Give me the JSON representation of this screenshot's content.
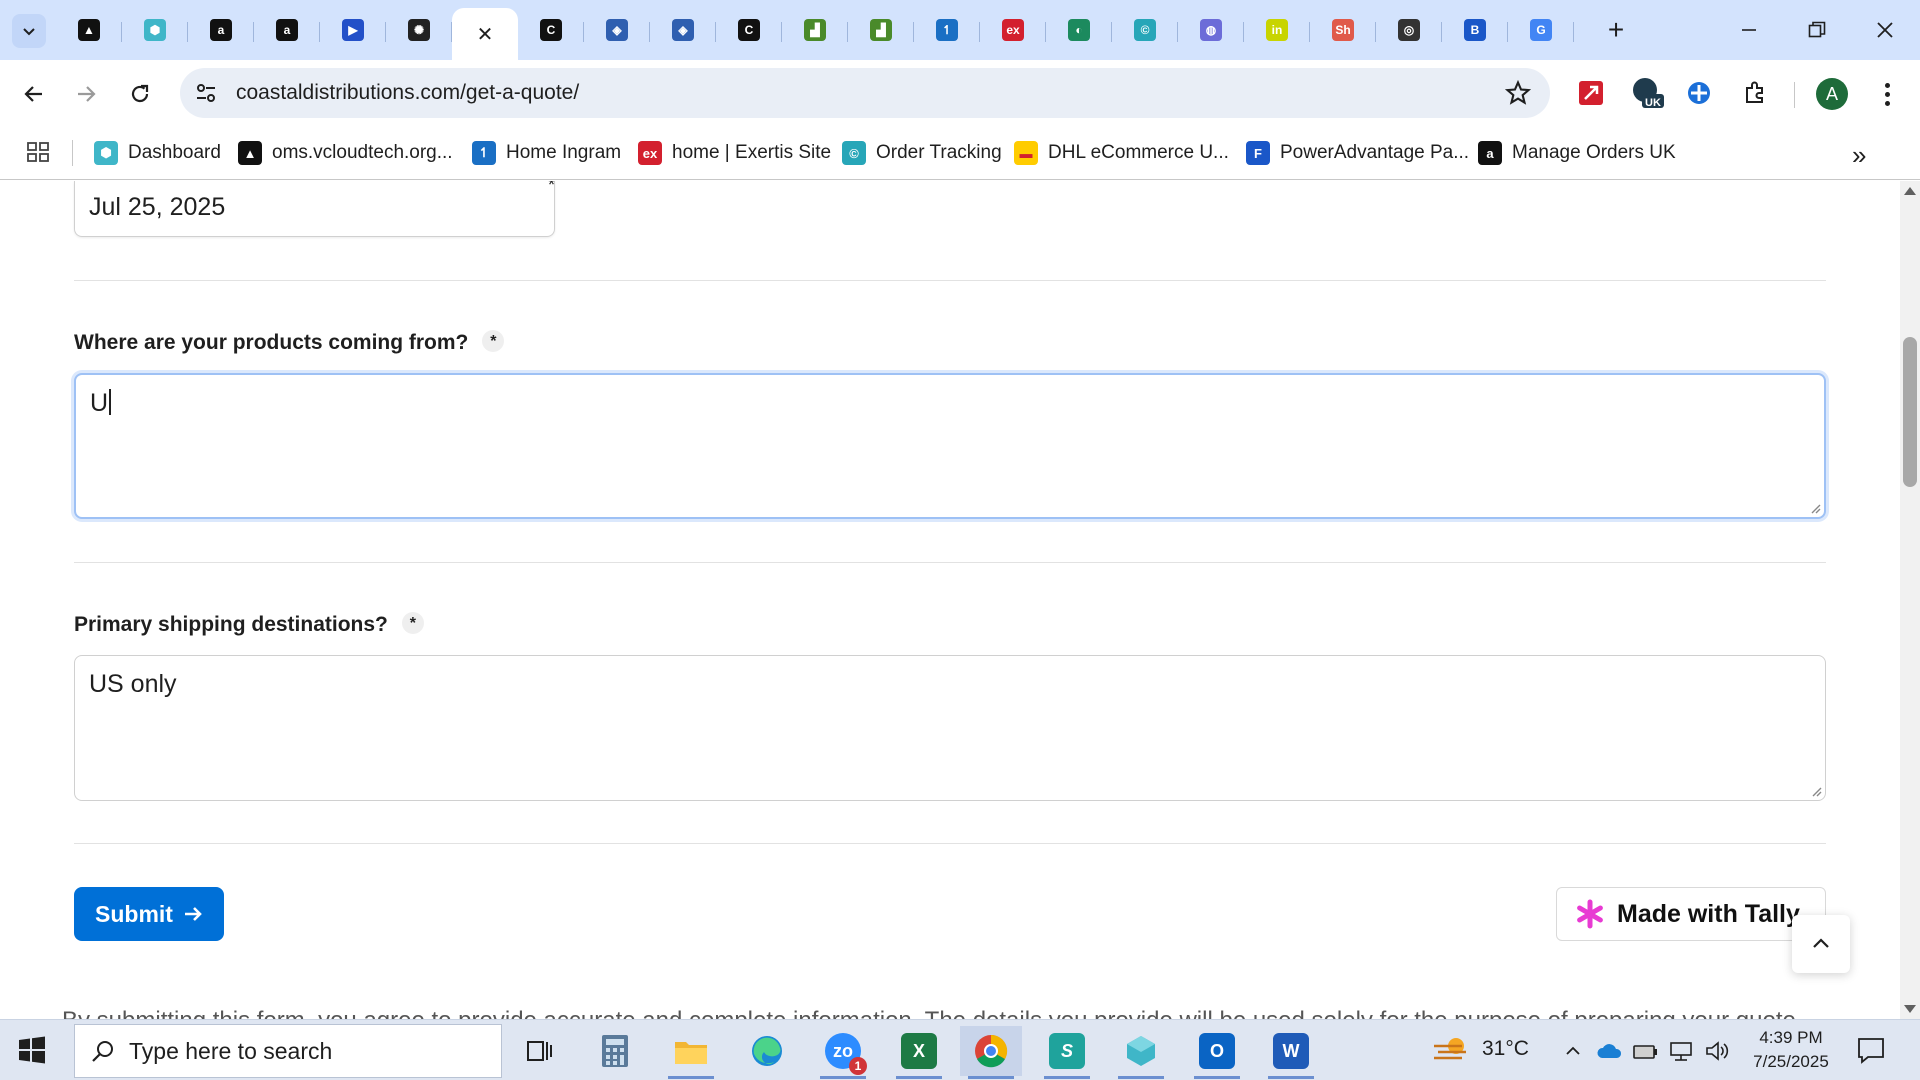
{
  "browser": {
    "tabs": [
      {
        "icon": "vercel-favicon-icon",
        "color": "#111111",
        "glyph": "▲"
      },
      {
        "icon": "cube-favicon-icon",
        "color": "#3fb6c8",
        "glyph": "⬢"
      },
      {
        "icon": "amazon-favicon-icon",
        "color": "#111111",
        "glyph": "a"
      },
      {
        "icon": "amazon-favicon-icon",
        "color": "#111111",
        "glyph": "a"
      },
      {
        "icon": "play-favicon-icon",
        "color": "#2350c8",
        "glyph": "▶"
      },
      {
        "icon": "openai-favicon-icon",
        "color": "#222222",
        "glyph": "✺"
      },
      {
        "icon": "close-tab-icon",
        "active": true
      },
      {
        "icon": "c-favicon-icon",
        "color": "#111111",
        "glyph": "C"
      },
      {
        "icon": "box-favicon-icon",
        "color": "#2f5fb0",
        "glyph": "◈"
      },
      {
        "icon": "box-favicon-icon",
        "color": "#2f5fb0",
        "glyph": "◈"
      },
      {
        "icon": "c-favicon-icon",
        "color": "#111111",
        "glyph": "C"
      },
      {
        "icon": "green-favicon-icon",
        "color": "#4a8a2a",
        "glyph": "▟"
      },
      {
        "icon": "green-favicon-icon",
        "color": "#4a8a2a",
        "glyph": "▟"
      },
      {
        "icon": "ingram-favicon-icon",
        "color": "#1a6fc4",
        "glyph": "↿"
      },
      {
        "icon": "exertis-favicon-icon",
        "color": "#d3202e",
        "glyph": "ex"
      },
      {
        "icon": "leaf-favicon-icon",
        "color": "#1c8a5e",
        "glyph": "◐"
      },
      {
        "icon": "c-circle-favicon-icon",
        "color": "#27a6b8",
        "glyph": "©"
      },
      {
        "icon": "chart-favicon-icon",
        "color": "#6c6cd8",
        "glyph": "◍"
      },
      {
        "icon": "infos-favicon-icon",
        "color": "#c8d400",
        "glyph": "in"
      },
      {
        "icon": "share-favicon-icon",
        "color": "#e05a4a",
        "glyph": "Sh"
      },
      {
        "icon": "chrome-favicon-icon",
        "color": "#333333",
        "glyph": "◎"
      },
      {
        "icon": "b-favicon-icon",
        "color": "#1a57c8",
        "glyph": "B"
      },
      {
        "icon": "google-favicon-icon",
        "color": "#4285f4",
        "glyph": "G"
      }
    ],
    "url": "coastaldistributions.com/get-a-quote/",
    "profile_initial": "A",
    "bookmarks": [
      {
        "label": "Dashboard",
        "color": "#3fb6c8",
        "glyph": "⬢"
      },
      {
        "label": "oms.vcloudtech.org...",
        "color": "#111111",
        "glyph": "▲"
      },
      {
        "label": "Home Ingram",
        "color": "#1a6fc4",
        "glyph": "↿"
      },
      {
        "label": "home | Exertis Site",
        "color": "#d3202e",
        "glyph": "ex"
      },
      {
        "label": "Order Tracking",
        "color": "#27a6b8",
        "glyph": "©"
      },
      {
        "label": "DHL eCommerce U...",
        "color": "#ffcc00",
        "glyph": "▬"
      },
      {
        "label": "PowerAdvantage Pa...",
        "color": "#1a57c8",
        "glyph": "F"
      },
      {
        "label": "Manage Orders UK",
        "color": "#111111",
        "glyph": "a"
      }
    ]
  },
  "form": {
    "date_value": "Jul 25, 2025",
    "q_origin_label": "Where are your products coming from?",
    "q_origin_value": "U",
    "q_dest_label": "Primary shipping destinations?",
    "q_dest_value": "US only",
    "required_mark": "*",
    "submit_label": "Submit",
    "tally_label": "Made with Tally",
    "partial_footer": "By submitting this form, you agree to provide accurate and complete information. The details you provide will be used solely for the purpose of preparing your quote."
  },
  "taskbar": {
    "search_placeholder": "Type here to search",
    "temperature": "31°C",
    "time": "4:39 PM",
    "date": "7/25/2025",
    "zoom_badge": "1"
  }
}
